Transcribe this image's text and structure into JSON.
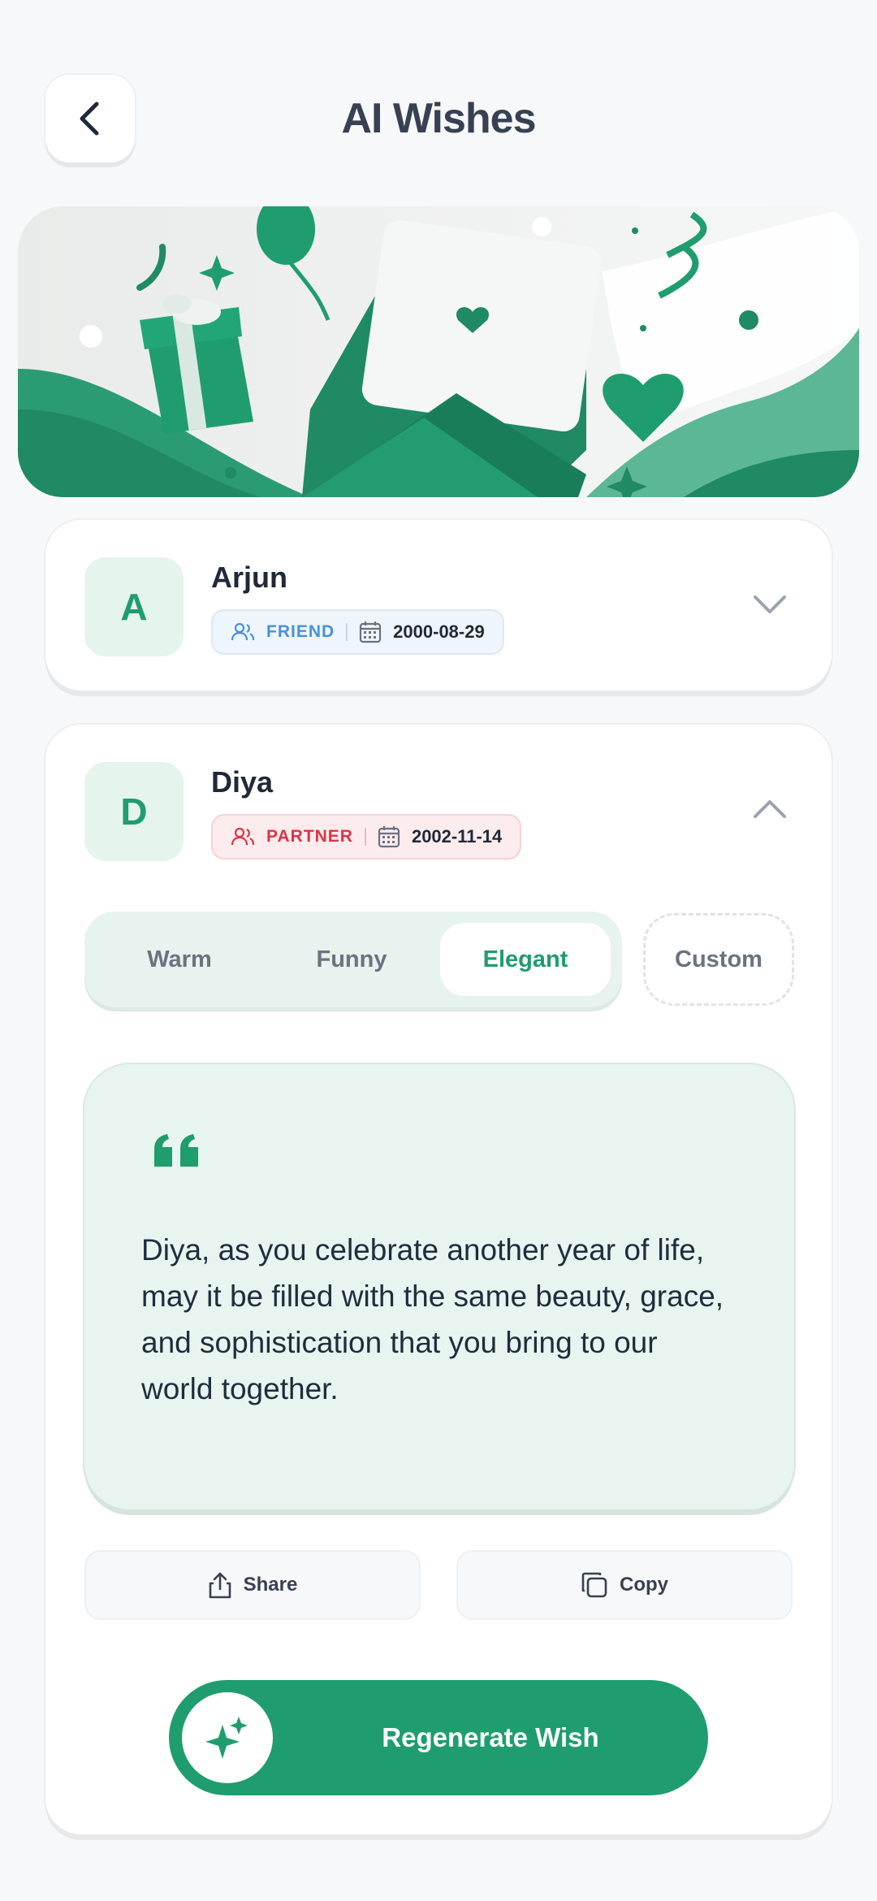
{
  "header": {
    "title": "AI Wishes",
    "back_icon": "chevron-left-icon"
  },
  "contacts": [
    {
      "initial": "A",
      "name": "Arjun",
      "relation": "FRIEND",
      "date": "2000-08-29",
      "expanded": false
    },
    {
      "initial": "D",
      "name": "Diya",
      "relation": "PARTNER",
      "date": "2002-11-14",
      "expanded": true
    }
  ],
  "tones": {
    "warm": "Warm",
    "funny": "Funny",
    "elegant": "Elegant",
    "custom": "Custom",
    "selected": "Elegant"
  },
  "wish": {
    "text": "Diya, as you celebrate another year of life, may it be filled with the same beauty, grace, and sophistication that you bring to our world together."
  },
  "actions": {
    "share": "Share",
    "copy": "Copy",
    "regenerate": "Regenerate Wish"
  },
  "colors": {
    "accent": "#1f9d6f",
    "friend": "#4a90d9",
    "partner": "#dc3545",
    "title": "#374151"
  }
}
